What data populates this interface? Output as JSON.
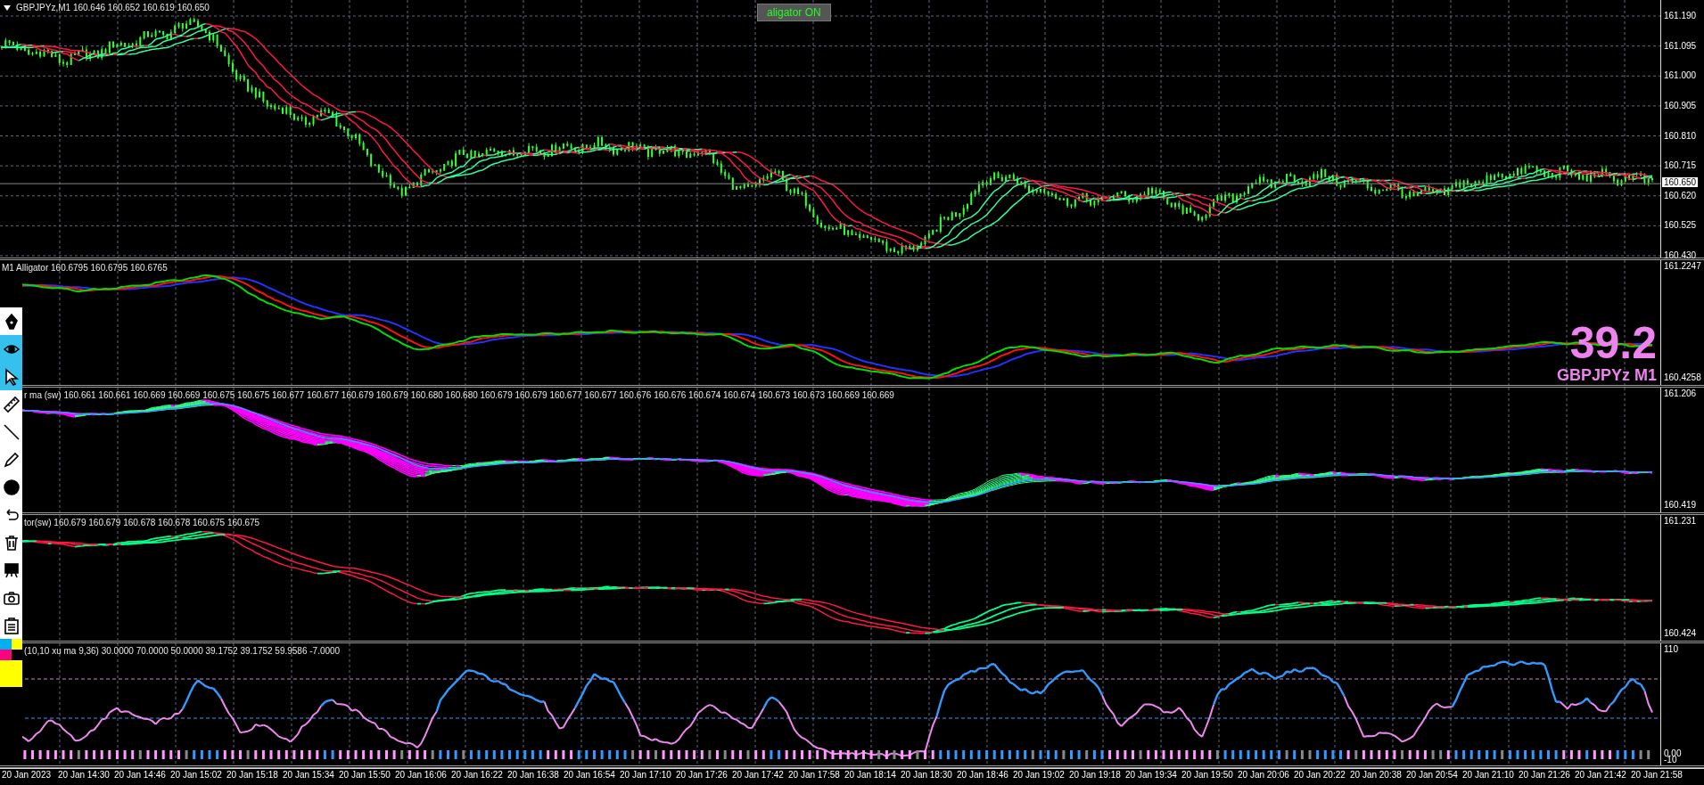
{
  "main_chart": {
    "header": "GBPJPYz,M1  160.646 160.652 160.619 160.650",
    "toggle_button": "aligator ON",
    "price_axis": [
      "161.190",
      "161.095",
      "161.000",
      "160.905",
      "160.810",
      "160.715",
      "160.620",
      "160.525",
      "160.430"
    ],
    "current_price": "160.650"
  },
  "overlay": {
    "value": "39.2",
    "label": "GBPJPYz M1"
  },
  "indicator_panels": [
    {
      "kind": "alligator",
      "header": "M1   Alligator 160.6795 160.6795 160.6765",
      "price_axis": [
        "161.2247",
        "160.4258"
      ]
    },
    {
      "kind": "ribbon",
      "header": "r ma (sw) 160.661 160.661 160.669 160.669 160.675 160.675 160.677 160.677 160.679 160.679 160.680 160.680 160.679 160.679 160.677 160.677 160.676 160.676 160.674 160.674 160.673 160.673 160.669 160.669",
      "price_axis": [
        "161.206",
        "160.419"
      ]
    },
    {
      "kind": "trend",
      "header": "tor(sw) 160.679 160.679 160.678 160.678 160.675 160.675",
      "price_axis": [
        "161.231",
        "160.424"
      ]
    }
  ],
  "oscillator": {
    "header": "(10,10 xu ma 9,36) 30.0000 70.0000 50.0000 39.1752 39.1752 59.9586 -7.0000",
    "axis": [
      "110",
      "0.00",
      "-10"
    ]
  },
  "time_axis": [
    "20 Jan 2023",
    "20 Jan 14:30",
    "20 Jan 14:46",
    "20 Jan 15:02",
    "20 Jan 15:18",
    "20 Jan 15:34",
    "20 Jan 15:50",
    "20 Jan 16:06",
    "20 Jan 16:22",
    "20 Jan 16:38",
    "20 Jan 16:54",
    "20 Jan 17:10",
    "20 Jan 17:26",
    "20 Jan 17:42",
    "20 Jan 17:58",
    "20 Jan 18:14",
    "20 Jan 18:30",
    "20 Jan 18:46",
    "20 Jan 19:02",
    "20 Jan 19:18",
    "20 Jan 19:34",
    "20 Jan 19:50",
    "20 Jan 20:06",
    "20 Jan 20:22",
    "20 Jan 20:38",
    "20 Jan 20:54",
    "20 Jan 21:10",
    "20 Jan 21:26",
    "20 Jan 21:42",
    "20 Jan 21:58"
  ],
  "toolbar": {
    "tools": [
      {
        "kind": "pen",
        "selected": false
      },
      {
        "kind": "eye",
        "selected": true
      },
      {
        "kind": "cursor",
        "selected": true
      },
      {
        "kind": "ruler",
        "selected": false
      },
      {
        "kind": "line",
        "selected": false
      },
      {
        "kind": "pencil",
        "selected": false
      },
      {
        "kind": "dot",
        "selected": false
      },
      {
        "kind": "undo",
        "selected": false
      },
      {
        "kind": "trash",
        "selected": false
      },
      {
        "kind": "easel",
        "selected": false
      },
      {
        "kind": "camera",
        "selected": false
      },
      {
        "kind": "clipboard",
        "selected": false
      }
    ],
    "swatches": [
      {
        "color": "#00b0f0"
      },
      {
        "color": "#ffff00"
      },
      {
        "color": "#ff0080"
      },
      {
        "color": "#000000"
      }
    ],
    "current_color": {
      "color": "#ffff00"
    }
  }
}
